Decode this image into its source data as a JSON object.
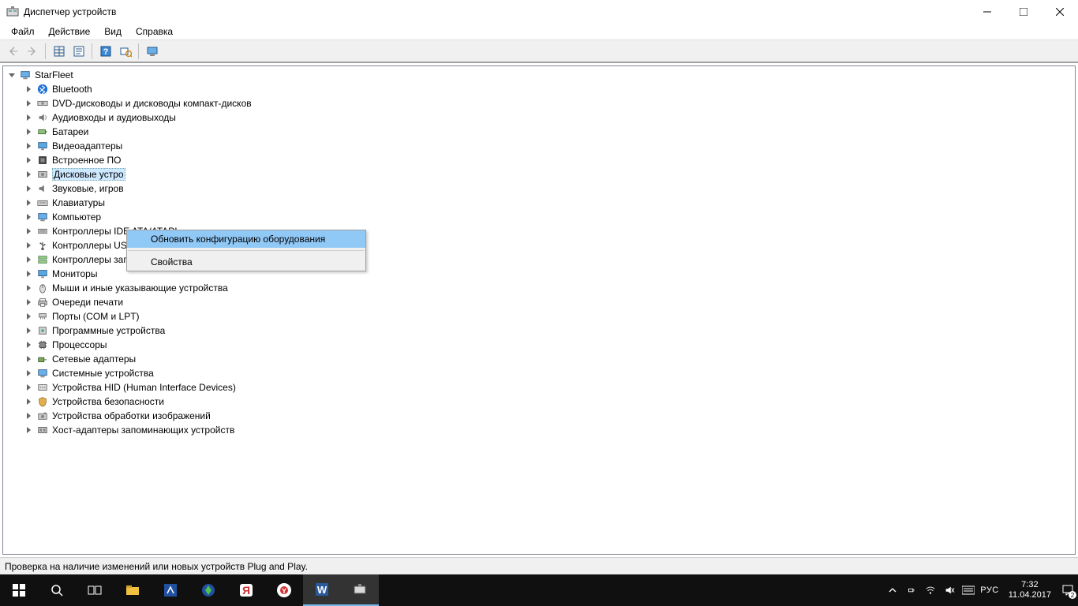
{
  "window": {
    "title": "Диспетчер устройств"
  },
  "menu": {
    "file": "Файл",
    "action": "Действие",
    "view": "Вид",
    "help": "Справка"
  },
  "tree": {
    "root": "StarFleet",
    "items": [
      "Bluetooth",
      "DVD-дисководы и дисководы компакт-дисков",
      "Аудиовходы и аудиовыходы",
      "Батареи",
      "Видеоадаптеры",
      "Встроенное ПО",
      "Дисковые устройства",
      "Звуковые, игровые и видеоустройства",
      "Клавиатуры",
      "Компьютер",
      "Контроллеры IDE ATA/ATAPI",
      "Контроллеры USB",
      "Контроллеры запоминающих устройств",
      "Мониторы",
      "Мыши и иные указывающие устройства",
      "Очереди печати",
      "Порты (COM и LPT)",
      "Программные устройства",
      "Процессоры",
      "Сетевые адаптеры",
      "Системные устройства",
      "Устройства HID (Human Interface Devices)",
      "Устройства безопасности",
      "Устройства обработки изображений",
      "Хост-адаптеры запоминающих устройств"
    ],
    "selected_index": 6,
    "selected_visible_text": "Дисковые устро"
  },
  "context_menu": {
    "scan": "Обновить конфигурацию оборудования",
    "props": "Свойства"
  },
  "status": "Проверка на наличие изменений или новых устройств Plug and Play.",
  "tray": {
    "lang": "РУС",
    "time": "7:32",
    "date": "11.04.2017",
    "badge": "2"
  },
  "visible_item_labels": {
    "7": "Звуковые, игров"
  }
}
